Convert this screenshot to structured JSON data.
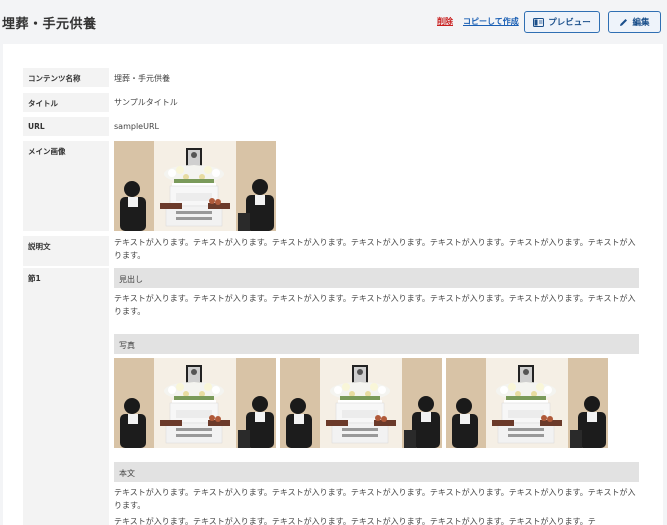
{
  "header": {
    "title": "埋葬・手元供養",
    "delete_label": "削除",
    "copy_label": "コピーして作成",
    "preview_label": "プレビュー",
    "edit_label": "編集"
  },
  "fields": {
    "content_name": {
      "label": "コンテンツ名称",
      "value": "埋葬・手元供養"
    },
    "title": {
      "label": "タイトル",
      "value": "サンプルタイトル"
    },
    "url": {
      "label": "URL",
      "value": "sampleURL"
    },
    "main_image": {
      "label": "メイン画像",
      "icon": "funeral-photo"
    },
    "description": {
      "label": "説明文",
      "text": "テキストが入ります。テキストが入ります。テキストが入ります。テキストが入ります。テキストが入ります。テキストが入ります。テキストが入ります。"
    },
    "section1": {
      "label": "節1",
      "heading_label": "見出し",
      "heading_text": "テキストが入ります。テキストが入ります。テキストが入ります。テキストが入ります。テキストが入ります。テキストが入ります。テキストが入ります。",
      "photos_label": "写真",
      "photos": [
        "funeral-photo",
        "funeral-photo",
        "funeral-photo"
      ],
      "body_label": "本文",
      "body_text": "テキストが入ります。テキストが入ります。テキストが入ります。テキストが入ります。テキストが入ります。テキストが入ります。テキストが入ります。",
      "body_text_2": "テキストが入ります。テキストが入ります。テキストが入ります。テキストが入ります。テキストが入ります。テキストが入ります。テ"
    }
  },
  "colors": {
    "accent": "#2f6fb3",
    "danger": "#c81e1e",
    "link": "#1a5fb4",
    "label_bg": "#f3f3f3",
    "subhead_bg": "#e2e2e2"
  }
}
